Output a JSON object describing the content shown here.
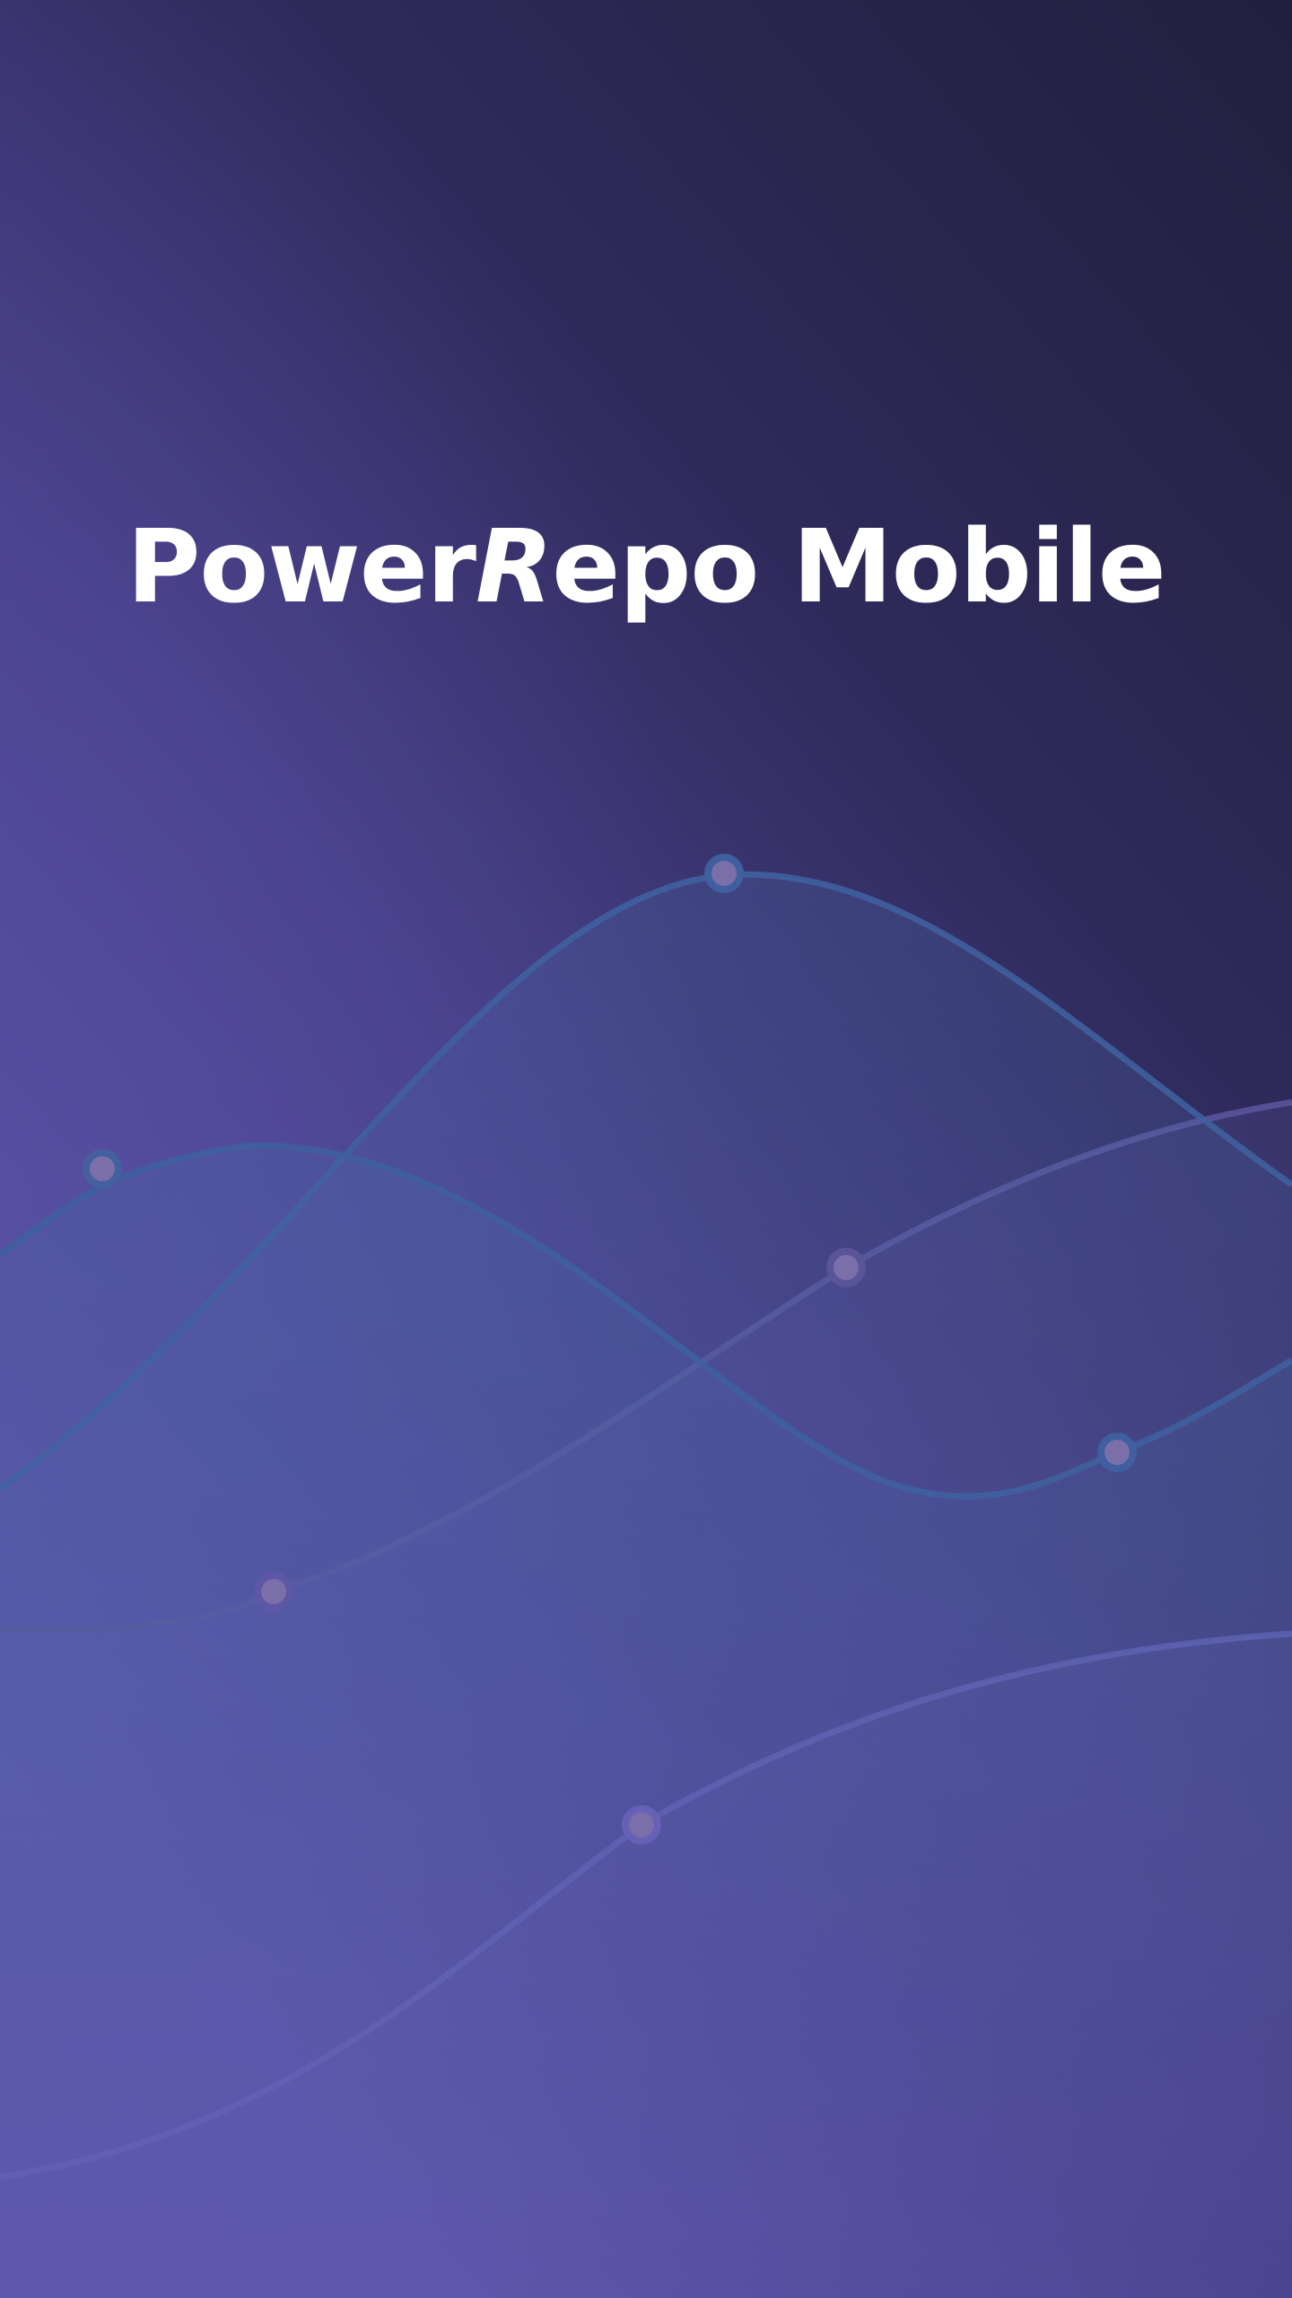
{
  "app": {
    "title_part1": "Power",
    "title_part2": "R",
    "title_part3": "epo Mobile"
  },
  "colors": {
    "background_top": "#242142",
    "background_mid": "#3d3670",
    "background_bottom": "#5d57ad",
    "wave_blue": "#3f5f9e",
    "wave_purple": "#6660b6",
    "marker_fill": "#7a6fa9",
    "title": "#ffffff"
  },
  "decorations": {
    "background": "splash-wave-graphic"
  }
}
